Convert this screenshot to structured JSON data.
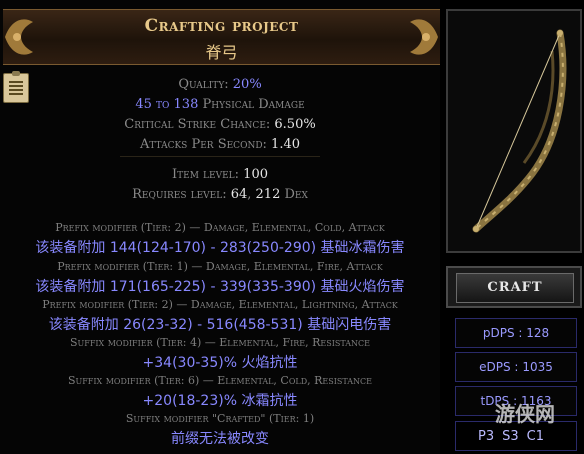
{
  "tooltip": {
    "title": "Crafting project",
    "subtitle": "脊弓",
    "props": [
      {
        "label": "Quality: ",
        "value": "20%"
      },
      {
        "value": "45 to 138",
        "label": " Physical Damage"
      },
      {
        "label": "Critical Strike Chance: ",
        "value": "6.50%"
      },
      {
        "label": "Attacks Per Second: ",
        "value": "1.40"
      }
    ],
    "item_level_label": "Item level: ",
    "item_level_value": "100",
    "requires_label": "Requires level: ",
    "requires_level": "64",
    "requires_dex": "212",
    "requires_dex_label": "Dex",
    "modifiers": [
      {
        "header": "Prefix modifier (Tier: 2) — Damage, Elemental, Cold, Attack",
        "text": "该装备附加 144(124-170) - 283(250-290) 基础冰霜伤害"
      },
      {
        "header": "Prefix modifier (Tier: 1) — Damage, Elemental, Fire, Attack",
        "text": "该装备附加 171(165-225) - 339(335-390) 基础火焰伤害"
      },
      {
        "header": "Prefix modifier (Tier: 2) — Damage, Elemental, Lightning, Attack",
        "text": "该装备附加 26(23-32) - 516(458-531) 基础闪电伤害"
      },
      {
        "header": "Suffix modifier (Tier: 4) — Elemental, Fire, Resistance",
        "text": "+34(30-35)% 火焰抗性"
      },
      {
        "header": "Suffix modifier (Tier: 6) — Elemental, Cold, Resistance",
        "text": "+20(18-23)% 冰霜抗性"
      },
      {
        "header": "Suffix modifier \"Crafted\" (Tier: 1)",
        "text": "前缀无法被改变"
      }
    ]
  },
  "craft_button": {
    "label": "CRAFT"
  },
  "stats": [
    {
      "label": "pDPS : ",
      "value": "128"
    },
    {
      "label": "eDPS : ",
      "value": "1035"
    },
    {
      "label": "tDPS : ",
      "value": "1163"
    }
  ],
  "sockets": [
    "P3",
    "S3",
    "C1"
  ],
  "watermark": "游侠网"
}
